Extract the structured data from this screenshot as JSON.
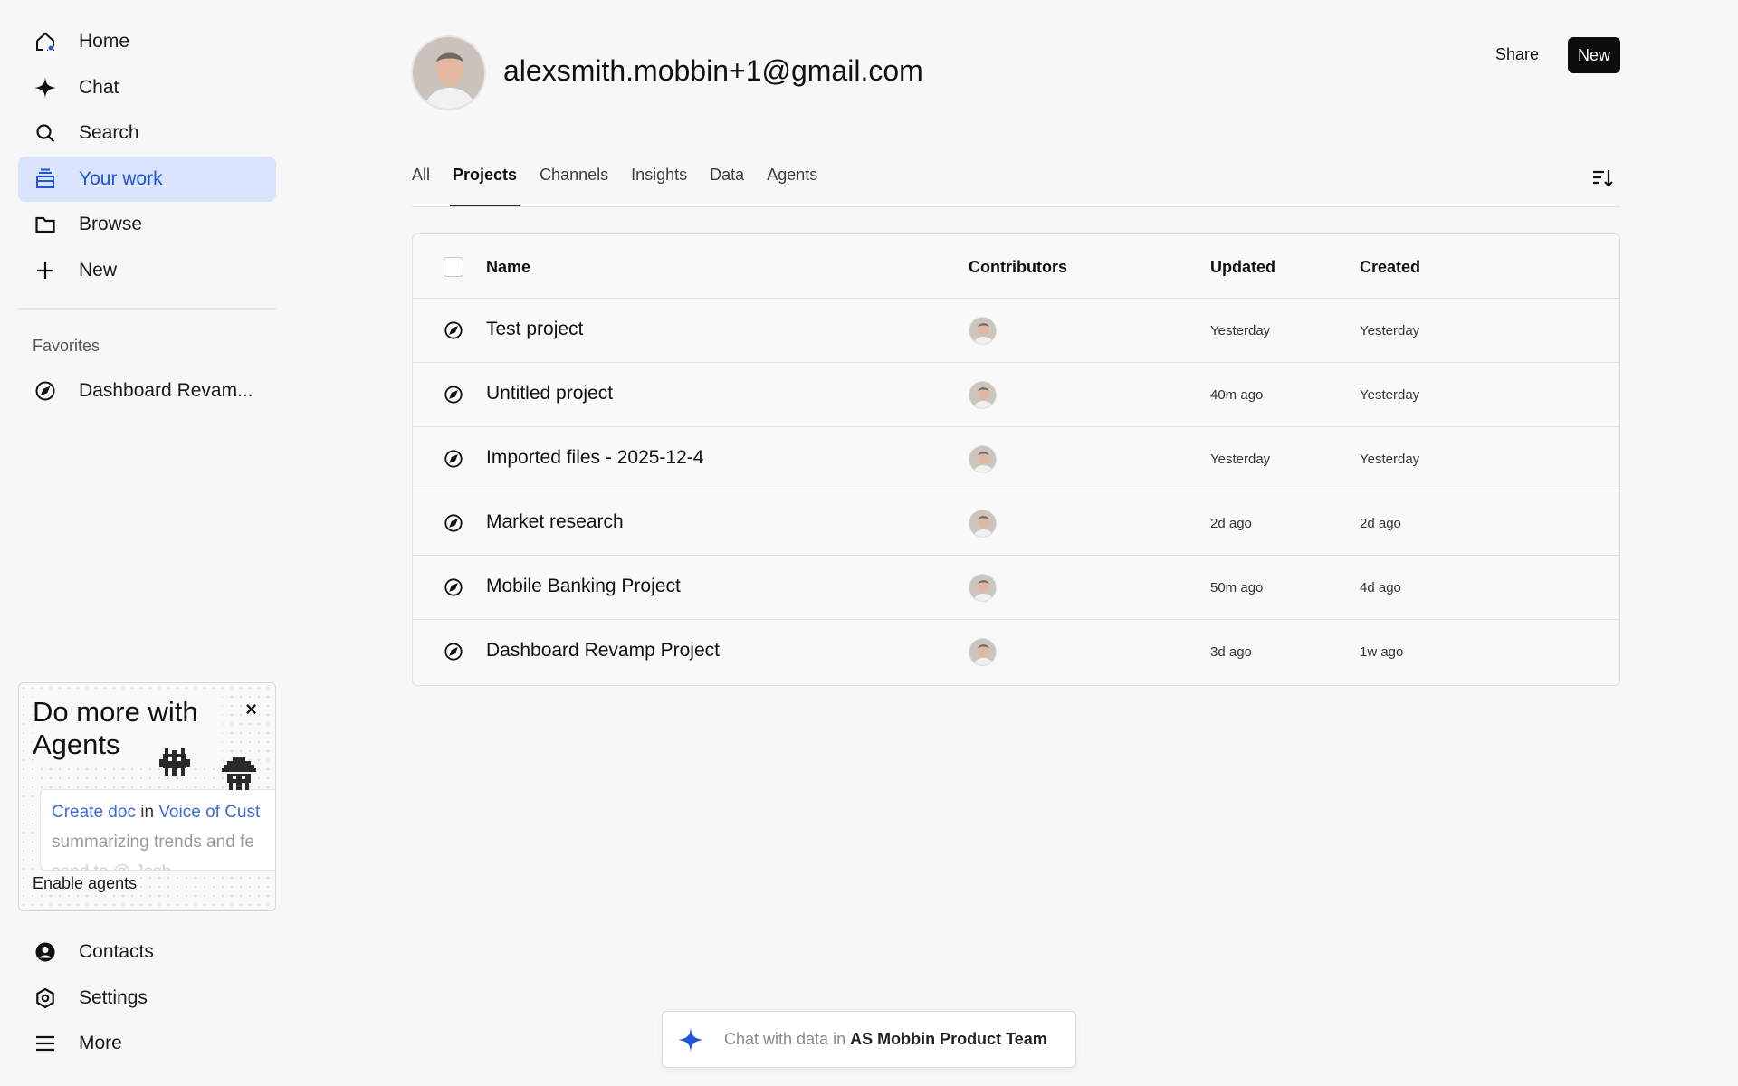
{
  "sidebar": {
    "nav": [
      {
        "label": "Home",
        "icon": "home-icon"
      },
      {
        "label": "Chat",
        "icon": "sparkle-icon"
      },
      {
        "label": "Search",
        "icon": "search-icon"
      },
      {
        "label": "Your work",
        "icon": "stack-icon",
        "active": true
      },
      {
        "label": "Browse",
        "icon": "folder-icon"
      },
      {
        "label": "New",
        "icon": "plus-icon"
      }
    ],
    "favorites_label": "Favorites",
    "favorites": [
      {
        "label": "Dashboard Revam...",
        "icon": "compass-icon"
      }
    ],
    "bottom": [
      {
        "label": "Contacts",
        "icon": "user-circle-icon"
      },
      {
        "label": "Settings",
        "icon": "hexagon-gear-icon"
      },
      {
        "label": "More",
        "icon": "menu-icon"
      }
    ]
  },
  "promo": {
    "title": "Do more with Agents",
    "close_label": "×",
    "card_action": "Create doc",
    "card_in": "in",
    "card_target": "Voice of Cust",
    "card_line2": "summarizing trends and fe",
    "card_line3": "send to @ Josh",
    "enable_label": "Enable agents"
  },
  "header": {
    "title": "alexsmith.mobbin+1@gmail.com",
    "share_label": "Share",
    "new_label": "New"
  },
  "tabs": [
    {
      "label": "All"
    },
    {
      "label": "Projects",
      "active": true
    },
    {
      "label": "Channels"
    },
    {
      "label": "Insights"
    },
    {
      "label": "Data"
    },
    {
      "label": "Agents"
    }
  ],
  "table": {
    "columns": {
      "name": "Name",
      "contributors": "Contributors",
      "updated": "Updated",
      "created": "Created"
    },
    "rows": [
      {
        "name": "Test project",
        "updated": "Yesterday",
        "created": "Yesterday"
      },
      {
        "name": "Untitled project",
        "updated": "40m ago",
        "created": "Yesterday"
      },
      {
        "name": "Imported files - 2025-12-4",
        "updated": "Yesterday",
        "created": "Yesterday"
      },
      {
        "name": "Market research",
        "updated": "2d ago",
        "created": "2d ago"
      },
      {
        "name": "Mobile Banking Project",
        "updated": "50m ago",
        "created": "4d ago"
      },
      {
        "name": "Dashboard Revamp Project",
        "updated": "3d ago",
        "created": "1w ago"
      }
    ]
  },
  "chatbar": {
    "prefix": "Chat with data in",
    "team": "AS Mobbin Product Team"
  },
  "colors": {
    "accent": "#2154d9",
    "active_bg": "#d9e4fa",
    "button_dark": "#0d0d0d",
    "background": "#f7f7f7"
  }
}
